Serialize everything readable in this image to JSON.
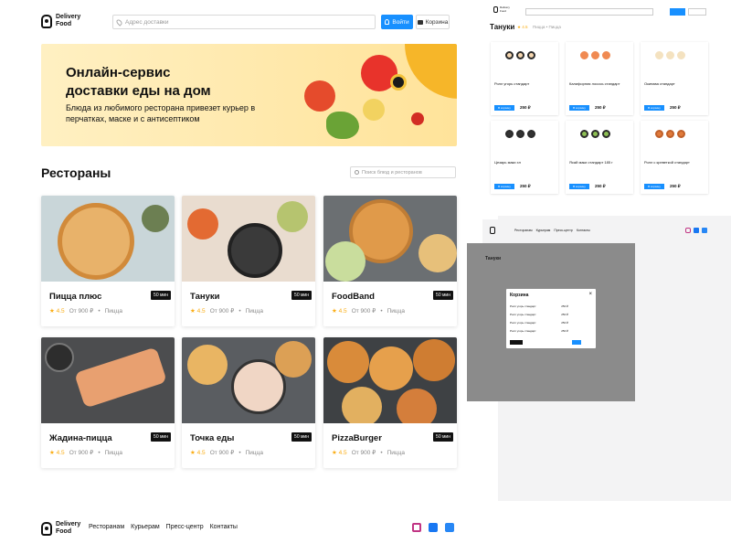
{
  "header": {
    "logo_line1": "Delivery",
    "logo_line2": "Food",
    "address_placeholder": "Адрес доставки",
    "login_label": "Войти",
    "cart_label": "Корзина"
  },
  "promo": {
    "title_line1": "Онлайн-сервис",
    "title_line2": "доставки еды на дом",
    "text": "Блюда из любимого ресторана привезет курьер в перчатках, маске и с антисептиком"
  },
  "restaurants": {
    "title": "Рестораны",
    "search_placeholder": "Поиск блюд и ресторанов",
    "items": [
      {
        "name": "Пицца плюс",
        "time": "50 мин",
        "rating": "4.5",
        "price": "От 900 ₽",
        "category": "Пицца"
      },
      {
        "name": "Тануки",
        "time": "50 мин",
        "rating": "4.5",
        "price": "От 900 ₽",
        "category": "Пицца"
      },
      {
        "name": "FoodBand",
        "time": "50 мин",
        "rating": "4.5",
        "price": "От 900 ₽",
        "category": "Пицца"
      },
      {
        "name": "Жадина-пицца",
        "time": "50 мин",
        "rating": "4.5",
        "price": "От 900 ₽",
        "category": "Пицца"
      },
      {
        "name": "Точка еды",
        "time": "50 мин",
        "rating": "4.5",
        "price": "От 900 ₽",
        "category": "Пицца"
      },
      {
        "name": "PizzaBurger",
        "time": "50 мин",
        "rating": "4.5",
        "price": "От 900 ₽",
        "category": "Пицца"
      }
    ]
  },
  "footer": {
    "links": [
      "Ресторанам",
      "Курьерам",
      "Пресс-центр",
      "Контакты"
    ]
  },
  "preview": {
    "title": "Тануки",
    "rating": "4.5",
    "meta": "Пицца • Пицца",
    "products": [
      {
        "name": "Ролл угорь стандарт",
        "price": "250 ₽",
        "cart": "В корзину"
      },
      {
        "name": "Калифорния лосось стандарт",
        "price": "250 ₽",
        "cart": "В корзину"
      },
      {
        "name": "Окинава стандарт",
        "price": "250 ₽",
        "cart": "В корзину"
      },
      {
        "name": "Цезарь маки хл",
        "price": "250 ₽",
        "cart": "В корзину"
      },
      {
        "name": "Ясай маки стандарт 185 г",
        "price": "250 ₽",
        "cart": "В корзину"
      },
      {
        "name": "Ролл с креветкой стандарт",
        "price": "250 ₽",
        "cart": "В корзину"
      }
    ],
    "modal_title": "Корзина",
    "modal_item": "Ролл угорь стандарт",
    "modal_price": "250 ₽"
  },
  "colors": {
    "primary": "#1890ff",
    "star": "#faad14",
    "dark": "#111111"
  },
  "icons": [
    "logo-icon",
    "pin-icon",
    "user-icon",
    "cart-icon",
    "search-icon",
    "instagram-icon",
    "facebook-icon",
    "vk-icon"
  ]
}
